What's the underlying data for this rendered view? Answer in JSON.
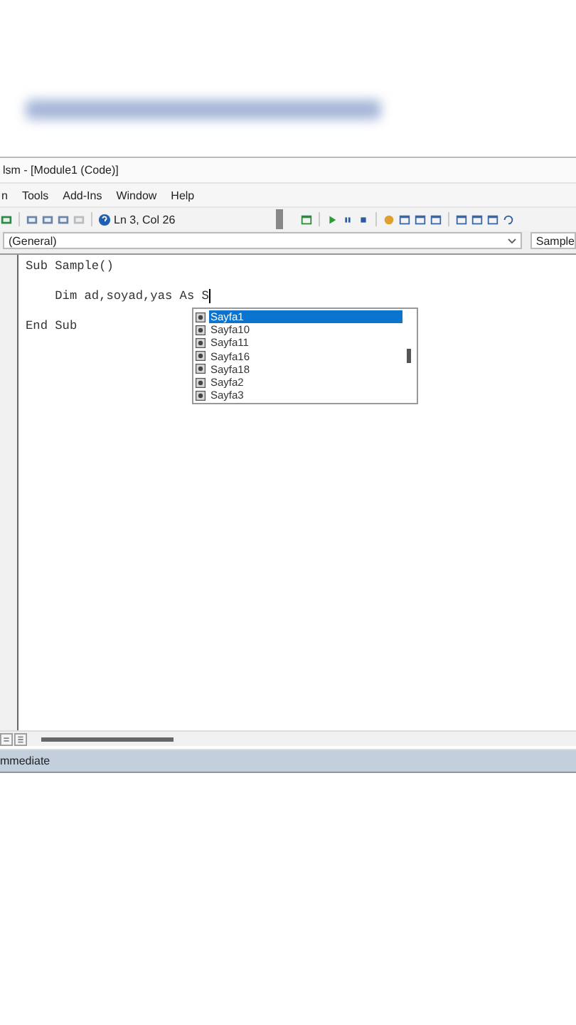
{
  "window": {
    "title": "lsm - [Module1 (Code)]"
  },
  "menu": [
    "n",
    "Tools",
    "Add-Ins",
    "Window",
    "Help"
  ],
  "toolbar": {
    "position": "Ln 3, Col 26"
  },
  "object_box": {
    "value": "(General)"
  },
  "procedure_box": {
    "value": "Sample"
  },
  "code_lines": [
    "Sub Sample()",
    "    Dim ad,soyad,yas As S",
    "End Sub"
  ],
  "autocomplete": [
    {
      "label": "Sayfa1",
      "selected": true
    },
    {
      "label": "Sayfa10",
      "selected": false
    },
    {
      "label": "Sayfa11",
      "selected": false
    },
    {
      "label": "Sayfa16",
      "selected": false
    },
    {
      "label": "Sayfa18",
      "selected": false
    },
    {
      "label": "Sayfa2",
      "selected": false
    },
    {
      "label": "Sayfa3",
      "selected": false
    }
  ],
  "immediate": {
    "title": "mmediate"
  }
}
